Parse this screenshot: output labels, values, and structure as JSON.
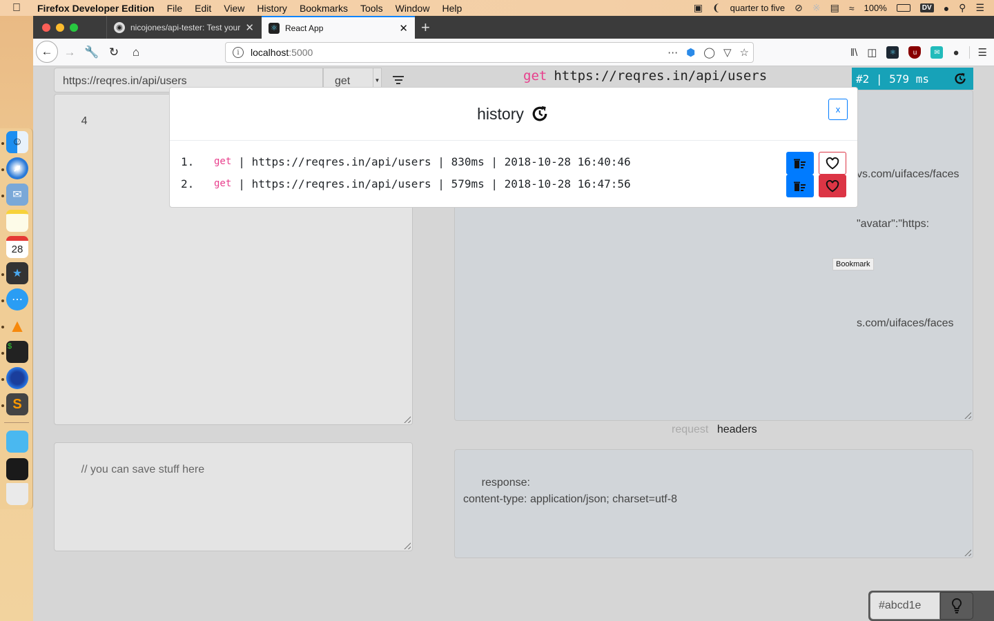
{
  "menubar": {
    "app_name": "Firefox Developer Edition",
    "items": [
      "File",
      "Edit",
      "View",
      "History",
      "Bookmarks",
      "Tools",
      "Window",
      "Help"
    ],
    "clock": "quarter to five",
    "battery": "100%",
    "dv_label": "DV"
  },
  "browser": {
    "tabs": [
      {
        "title": "nicojones/api-tester: Test your API",
        "icon": "github-icon",
        "active": false
      },
      {
        "title": "React App",
        "icon": "react-icon",
        "active": true
      }
    ],
    "url_host": "localhost",
    "url_port": ":5000",
    "tooltip": "Bookmark"
  },
  "request": {
    "url": "https://reqres.in/api/users",
    "method": "get",
    "body": "4",
    "notes_placeholder": "// you can save stuff here"
  },
  "response": {
    "summary_method": "get",
    "summary_url": "https://reqres.in/api/users",
    "badge": "#2 | 579 ms",
    "body_lines": [
      "vs.com/uifaces/faces",
      "\"avatar\":\"https:",
      "",
      "s.com/uifaces/faces"
    ],
    "toggle_request": "request",
    "toggle_headers": "headers",
    "headers_text": "response:\ncontent-type: application/json; charset=utf-8"
  },
  "theme": {
    "color_value": "#abcd1e"
  },
  "history_modal": {
    "title": "history",
    "close_label": "x",
    "entries": [
      {
        "index": "1.",
        "method": "get",
        "url": "https://reqres.in/api/users",
        "time": "830ms",
        "timestamp": "2018-10-28 16:40:46",
        "favorited": false
      },
      {
        "index": "2.",
        "method": "get",
        "url": "https://reqres.in/api/users",
        "time": "579ms",
        "timestamp": "2018-10-28 16:47:56",
        "favorited": true
      }
    ]
  },
  "colors": {
    "accent_teal": "#17a2b8",
    "method_pink": "#e83e8c",
    "primary_blue": "#007bff",
    "danger_red": "#dc3545"
  }
}
